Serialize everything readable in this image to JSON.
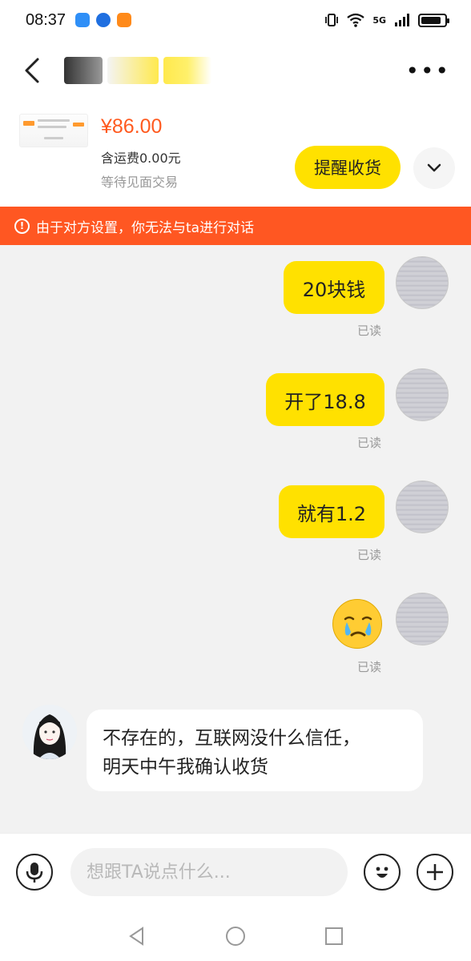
{
  "status_bar": {
    "time": "08:37",
    "network": "5G",
    "battery_level": 0.85
  },
  "header": {
    "back_icon": "chevron-left-icon",
    "more_label": "•••"
  },
  "product": {
    "price": "¥86.00",
    "shipping": "含运费0.00元",
    "status": "等待见面交易",
    "remind_button": "提醒收货",
    "expand_icon": "chevron-down-icon"
  },
  "banner": {
    "text": "由于对方设置，你无法与ta进行对话"
  },
  "messages": {
    "m1": {
      "text": "20块钱",
      "read": "已读"
    },
    "m2": {
      "text": "开了18.8",
      "read": "已读"
    },
    "m3": {
      "text": "就有1.2",
      "read": "已读"
    },
    "m4": {
      "emoji": "crying-face-emoji",
      "read": "已读"
    },
    "m5": {
      "line1": "不存在的，互联网没什么信任，",
      "line2": "明天中午我确认收货"
    }
  },
  "input": {
    "placeholder": "想跟TA说点什么..."
  },
  "colors": {
    "accent_yellow": "#ffe100",
    "price_orange": "#ff5a1f",
    "banner_orange": "#ff5722"
  }
}
